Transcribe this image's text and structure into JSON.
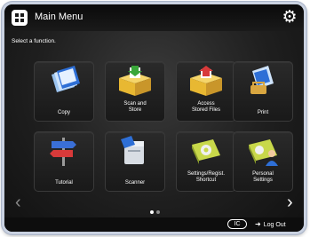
{
  "header": {
    "title": "Main Menu"
  },
  "instruction": "Select a function.",
  "tiles": [
    {
      "label": "Copy",
      "icon": "copy-icon"
    },
    {
      "label": "Scan and\nStore",
      "icon": "scan-and-store-icon"
    },
    {
      "label": "Access\nStored Files",
      "icon": "access-stored-files-icon"
    },
    {
      "label": "Print",
      "icon": "print-icon"
    },
    {
      "label": "Tutorial",
      "icon": "tutorial-icon"
    },
    {
      "label": "Scanner",
      "icon": "scanner-icon"
    },
    {
      "label": "Settings/Regist.\nShortcut",
      "icon": "settings-icon"
    },
    {
      "label": "Personal\nSettings",
      "icon": "personal-settings-icon"
    }
  ],
  "pagination": {
    "current_page": 1,
    "total_pages": 2
  },
  "footer": {
    "logout_label": "Log Out",
    "nfc_label": "IC"
  },
  "colors": {
    "background": "#1f1f1f",
    "accent_blue": "#2e6fd6",
    "folder_yellow": "#e8b832"
  }
}
